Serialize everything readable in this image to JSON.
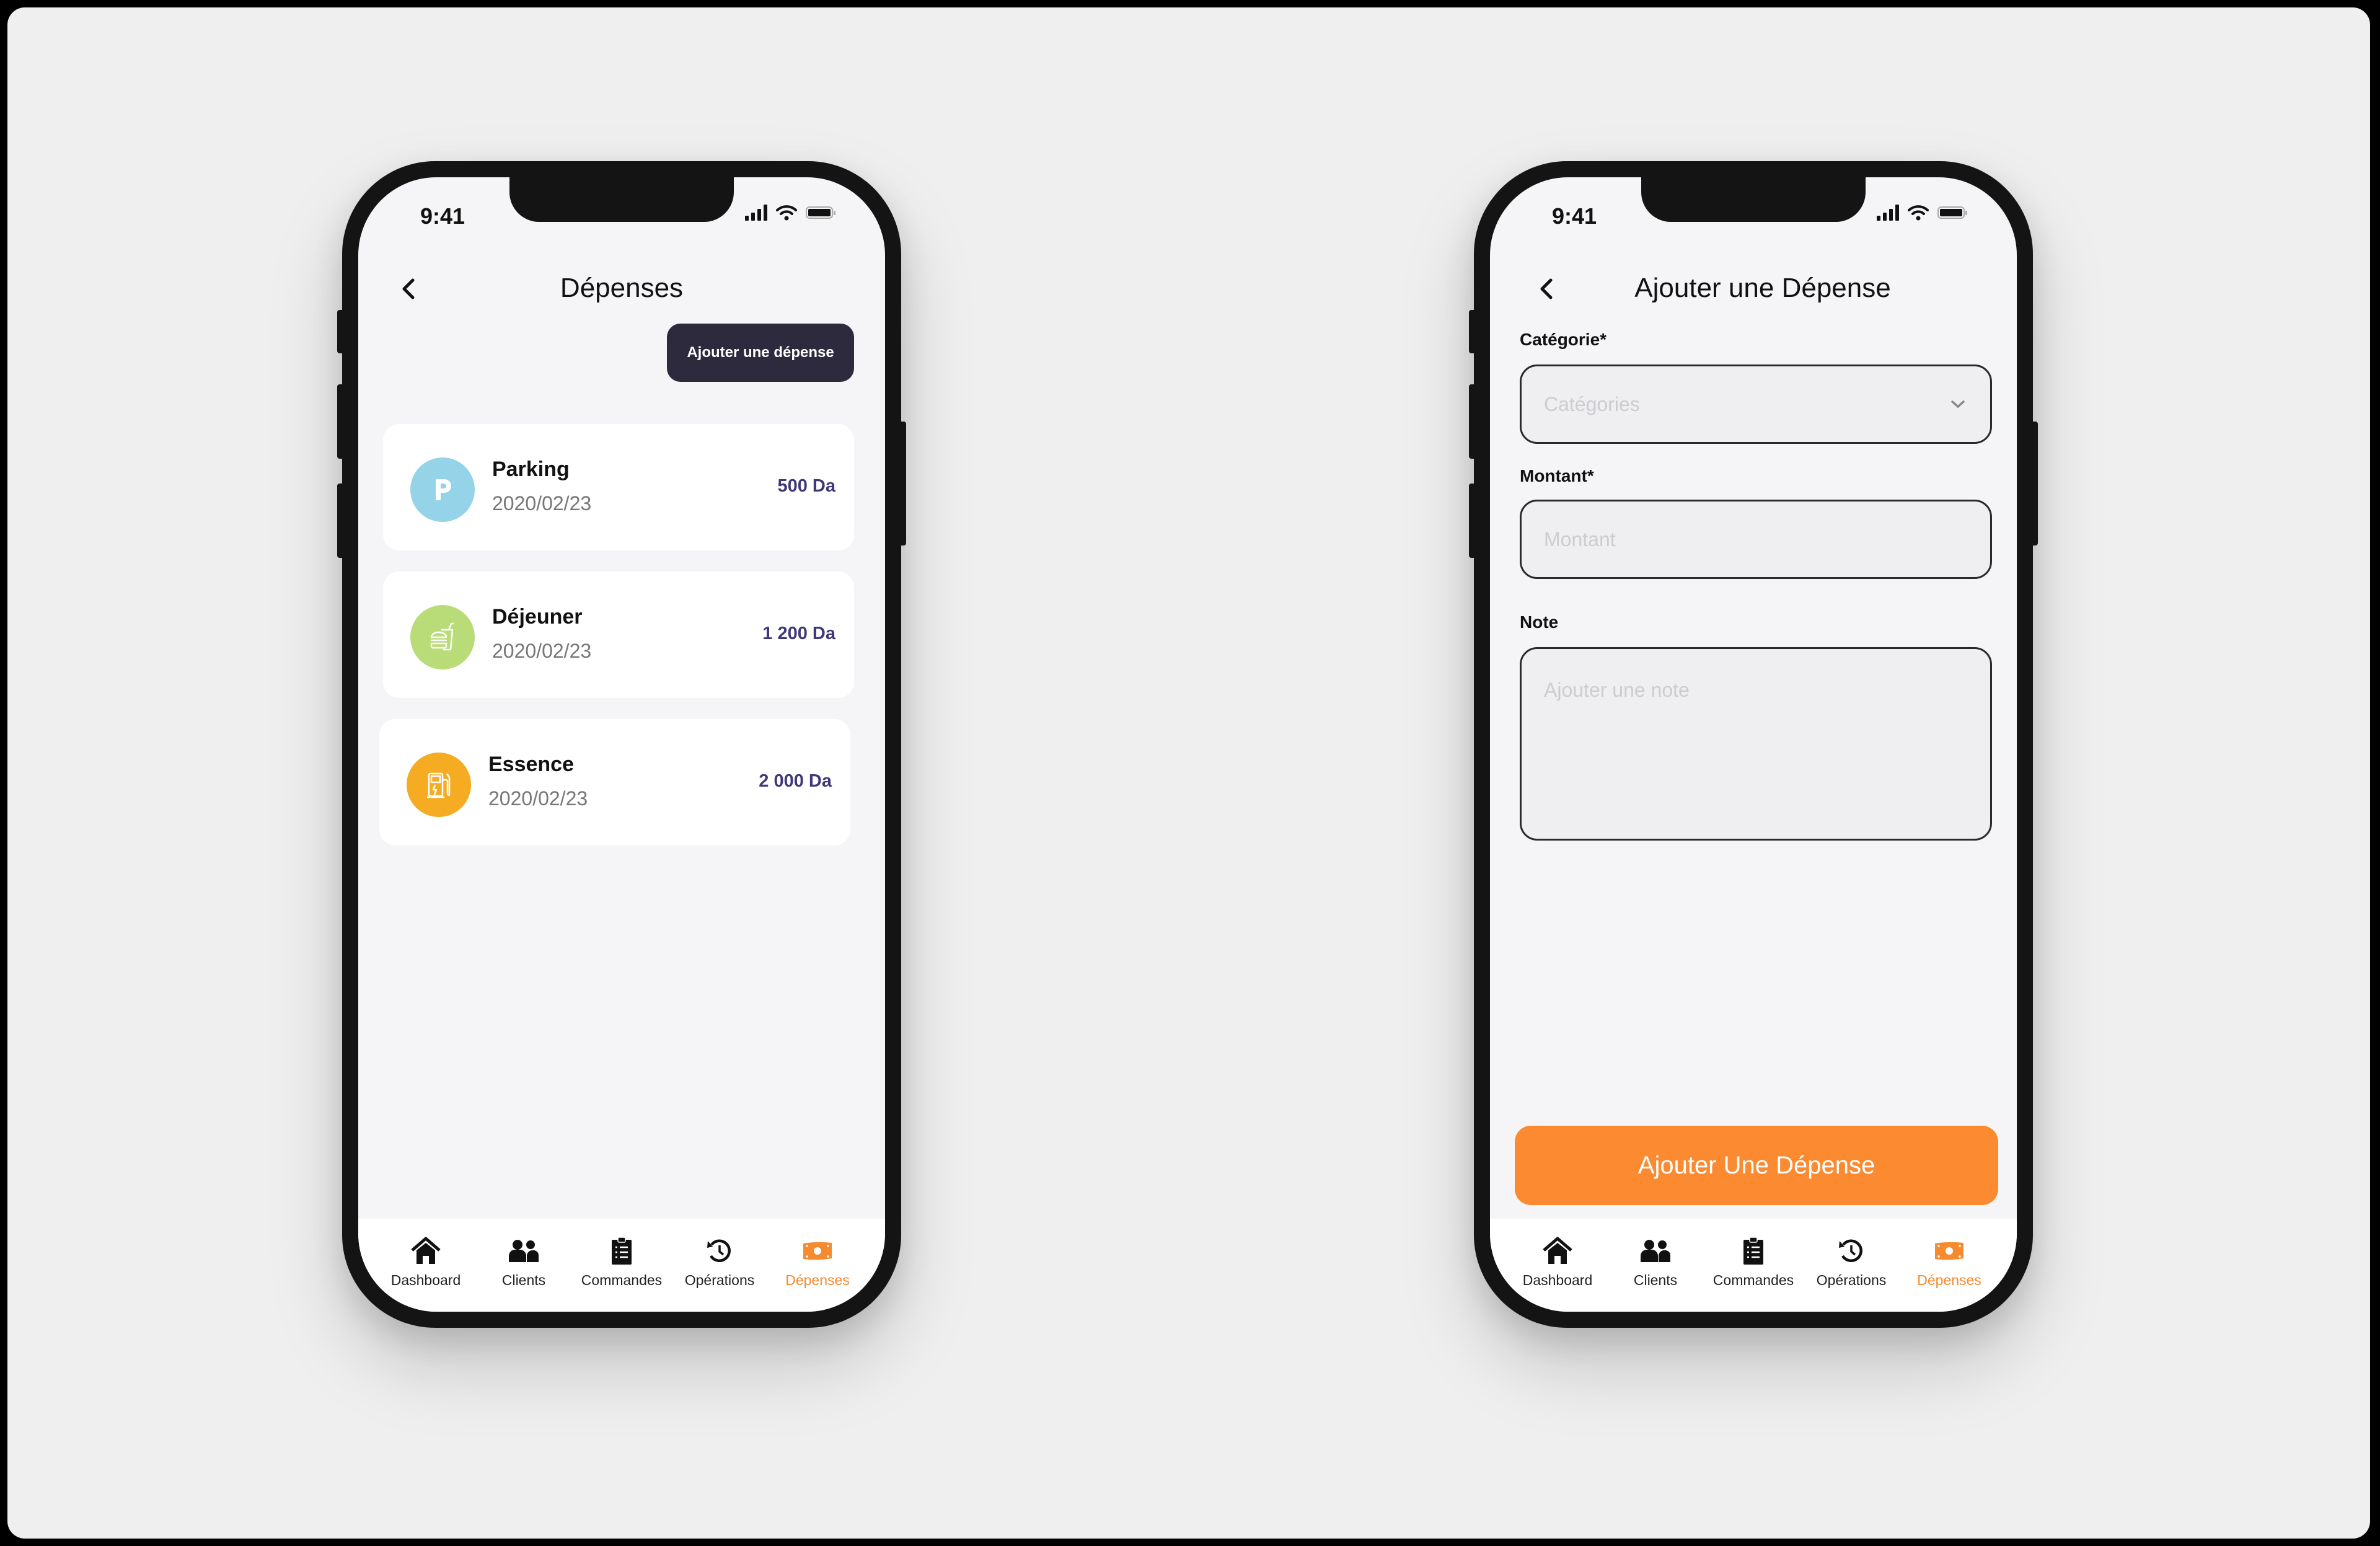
{
  "status_bar": {
    "time": "9:41"
  },
  "screens": {
    "list": {
      "title": "Dépenses",
      "add_button_label": "Ajouter une dépense",
      "expenses": [
        {
          "name": "Parking",
          "date": "2020/02/23",
          "amount": "500 Da",
          "icon": "parking-icon",
          "color": "#94d3e8"
        },
        {
          "name": "Déjeuner",
          "date": "2020/02/23",
          "amount": "1 200 Da",
          "icon": "fast-food-icon",
          "color": "#b9dc78"
        },
        {
          "name": "Essence",
          "date": "2020/02/23",
          "amount": "2 000 Da",
          "icon": "fuel-pump-icon",
          "color": "#f5ac22"
        }
      ]
    },
    "form": {
      "title": "Ajouter une Dépense",
      "category_label": "Catégorie*",
      "category_placeholder": "Catégories",
      "amount_label": "Montant*",
      "amount_placeholder": "Montant",
      "note_label": "Note",
      "note_placeholder": "Ajouter une note",
      "submit_label": "Ajouter Une Dépense"
    }
  },
  "tabbar": {
    "active": "Dépenses",
    "items": [
      {
        "label": "Dashboard",
        "icon": "home-icon"
      },
      {
        "label": "Clients",
        "icon": "users-icon"
      },
      {
        "label": "Commandes",
        "icon": "clipboard-list-icon"
      },
      {
        "label": "Opérations",
        "icon": "history-icon"
      },
      {
        "label": "Dépenses",
        "icon": "money-bill-icon"
      }
    ]
  },
  "colors": {
    "accent": "#fb8a30",
    "dark_button": "#2d2a3e",
    "amount_text": "#3f3879"
  }
}
